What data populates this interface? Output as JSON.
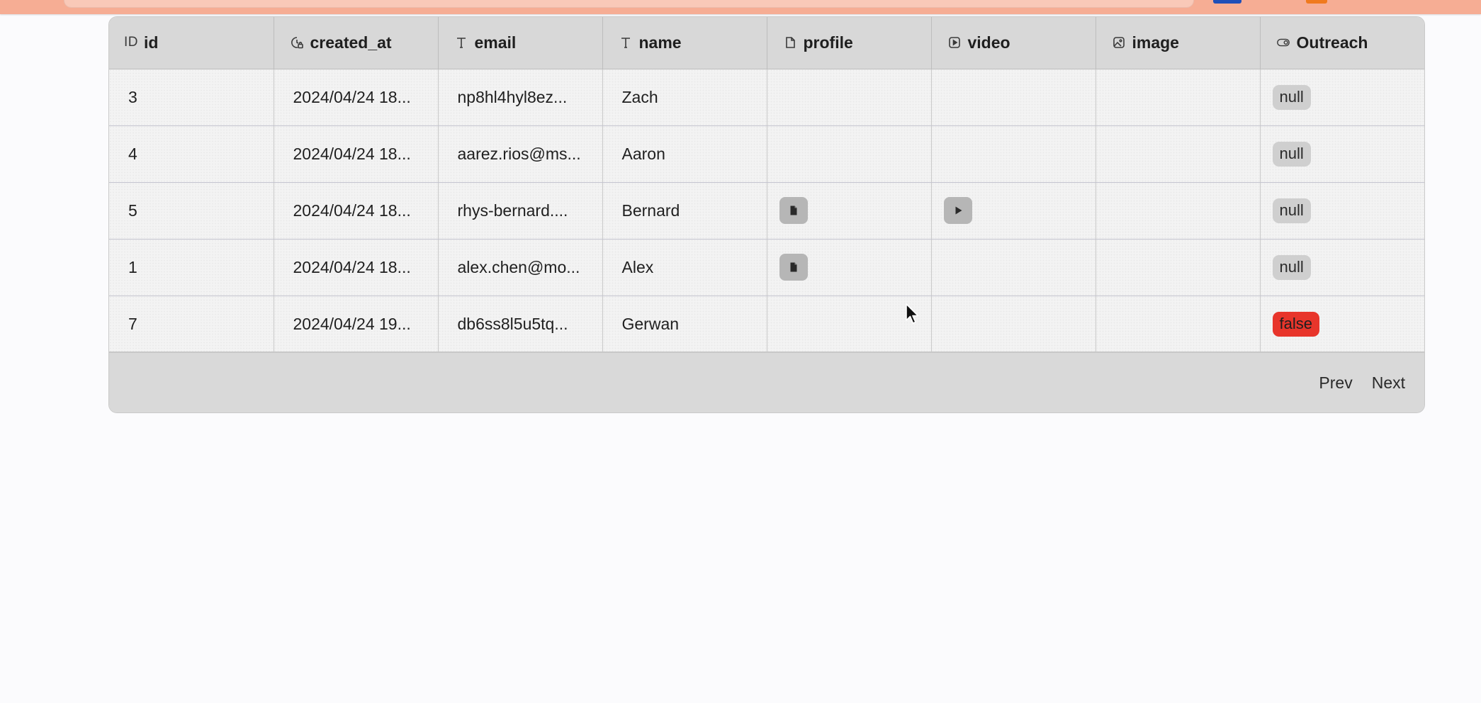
{
  "colors": {
    "browser_bar": "#f6ad94",
    "header_bg": "#d8d8d8",
    "row_bg": "#f3f3f3",
    "footer_bg": "#d9d9d9",
    "badge_null": "#cfcfcf",
    "badge_false": "#e8352b"
  },
  "table": {
    "columns": [
      {
        "key": "id",
        "label": "id",
        "icon": "id-text-icon",
        "icon_glyph": "ID"
      },
      {
        "key": "created_at",
        "label": "created_at",
        "icon": "clock-lock-icon"
      },
      {
        "key": "email",
        "label": "email",
        "icon": "text-type-icon"
      },
      {
        "key": "name",
        "label": "name",
        "icon": "text-type-icon"
      },
      {
        "key": "profile",
        "label": "profile",
        "icon": "file-icon"
      },
      {
        "key": "video",
        "label": "video",
        "icon": "play-square-icon"
      },
      {
        "key": "image",
        "label": "image",
        "icon": "image-icon"
      },
      {
        "key": "outreach",
        "label": "Outreach",
        "icon": "toggle-icon"
      }
    ],
    "rows": [
      {
        "id": "3",
        "created_at": "2024/04/24 18...",
        "email": "np8hl4hyl8ez...",
        "name": "Zach",
        "profile": null,
        "video": null,
        "image": null,
        "outreach": "null"
      },
      {
        "id": "4",
        "created_at": "2024/04/24 18...",
        "email": "aarez.rios@ms...",
        "name": "Aaron",
        "profile": null,
        "video": null,
        "image": null,
        "outreach": "null"
      },
      {
        "id": "5",
        "created_at": "2024/04/24 18...",
        "email": "rhys-bernard....",
        "name": "Bernard",
        "profile": "file-icon",
        "video": "play-icon",
        "image": null,
        "outreach": "null"
      },
      {
        "id": "1",
        "created_at": "2024/04/24 18...",
        "email": "alex.chen@mo...",
        "name": "Alex",
        "profile": "file-icon",
        "video": null,
        "image": null,
        "outreach": "null"
      },
      {
        "id": "7",
        "created_at": "2024/04/24 19...",
        "email": "db6ss8l5u5tq...",
        "name": "Gerwan",
        "profile": null,
        "video": null,
        "image": null,
        "outreach": "false"
      }
    ]
  },
  "pagination": {
    "prev_label": "Prev",
    "next_label": "Next"
  }
}
